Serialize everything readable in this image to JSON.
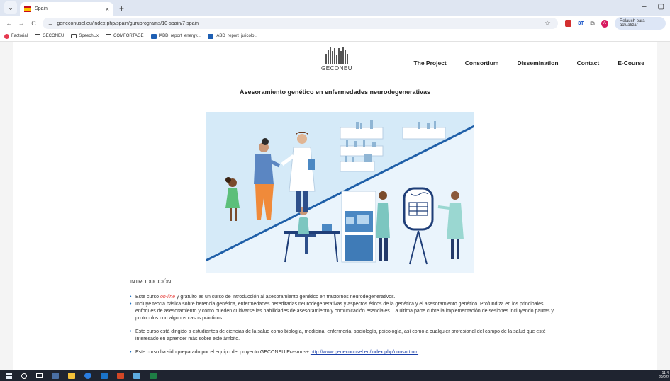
{
  "browser": {
    "tab_title": "Spain",
    "tab_close": "×",
    "new_tab": "+",
    "url": "geneconusel.eu/index.php/spain/guruprograms/10-spain/7-spain",
    "update_label": "Relauch para actualizar",
    "profile_initial": "A",
    "ext_label": "ЗТ",
    "window_controls": [
      "–",
      "▢"
    ]
  },
  "bookmarks": [
    {
      "label": "Factorial",
      "icon": "factorial-icon"
    },
    {
      "label": "GECONEU",
      "icon": "folder-icon"
    },
    {
      "label": "SpeechUx",
      "icon": "folder-icon"
    },
    {
      "label": "COMFORTAGE",
      "icon": "folder-icon"
    },
    {
      "label": "IABD_report_energy...",
      "icon": "doc-icon"
    },
    {
      "label": "IABD_report_julicolo...",
      "icon": "doc-icon"
    }
  ],
  "site": {
    "logo_text": "GECONEU",
    "nav": [
      "The Project",
      "Consortium",
      "Dissemination",
      "Contact",
      "E-Course"
    ],
    "title": "Asesoramiento genético en enfermedades neurodegenerativas"
  },
  "content": {
    "intro_heading": "INTRODUCCIÓN",
    "b1_pre": "Este curso ",
    "b1_highlight": "on-line",
    "b1_post": " y gratuito es un curso de introducción al asesoramiento genético en trastornos neurodegenerativos.",
    "b2": "Incluye teoría básica sobre herencia genética, enfermedades hereditarias neurodegenerativas y aspectos éticos de la genética y el asesoramiento genético. Profundiza en los principales enfoques de asesoramiento y cómo pueden cultivarse las habilidades de asesoramiento y comunicación esenciales. La última parte cubre la implementación de sesiones incluyendo pautas y protocolos con algunos casos prácticos.",
    "b3": "Este curso está dirigido a estudiantes de ciencias de la salud como biología, medicina, enfermería, sociología, psicología, así como a cualquier profesional del campo de la salud que esté interesado en aprender más sobre este ámbito.",
    "b4_pre": "Este curso ha sido preparado por el equipo del proyecto GECONEU Erasmus+ ",
    "b4_link": "http://www.genecounsel.eu/index.php/consortium"
  },
  "taskbar": {
    "time": "11:4",
    "date": "29/07/"
  }
}
